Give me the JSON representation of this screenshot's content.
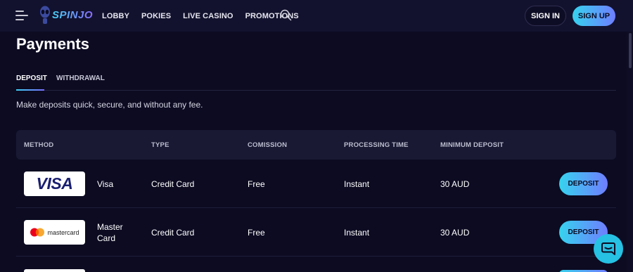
{
  "header": {
    "logo_text": "SPINJO",
    "nav": [
      "LOBBY",
      "POKIES",
      "LIVE CASINO",
      "PROMOTIONS"
    ],
    "sign_in": "SIGN IN",
    "sign_up": "SIGN UP"
  },
  "page": {
    "title": "Payments",
    "tabs": [
      "DEPOSIT",
      "WITHDRAWAL"
    ],
    "active_tab": "DEPOSIT",
    "intro": "Make deposits quick, secure, and without any fee."
  },
  "table": {
    "headers": [
      "METHOD",
      "TYPE",
      "COMISSION",
      "PROCESSING TIME",
      "MINIMUM DEPOSIT"
    ],
    "rows": [
      {
        "logo_text": "VISA",
        "method": "Visa",
        "type": "Credit Card",
        "commission": "Free",
        "processing_time": "Instant",
        "minimum_deposit": "30 AUD",
        "action": "DEPOSIT"
      },
      {
        "logo_text": "mastercard",
        "method": "Master Card",
        "type": "Credit Card",
        "commission": "Free",
        "processing_time": "Instant",
        "minimum_deposit": "30 AUD",
        "action": "DEPOSIT"
      }
    ]
  },
  "colors": {
    "background": "#0c0b22",
    "header": "#13122e",
    "accent_start": "#36d3ee",
    "accent_end": "#6f7dff",
    "chat": "#26c1e3"
  },
  "icons": [
    "hamburger-menu-icon",
    "search-icon",
    "chat-icon"
  ]
}
